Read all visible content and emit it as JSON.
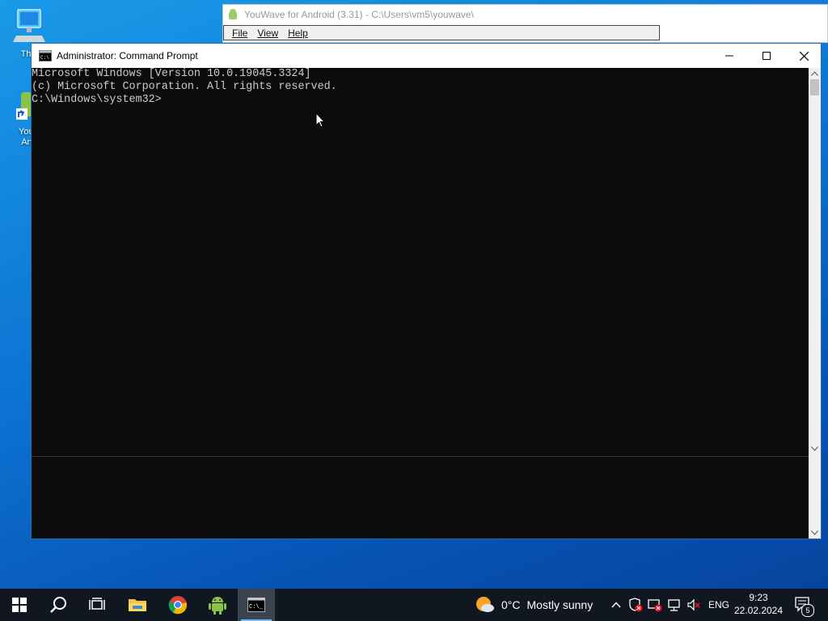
{
  "desktop": {
    "icons": [
      {
        "label": "This",
        "name": "this-pc"
      },
      {
        "label": "YouWave for Android",
        "label_line1": "YouV",
        "label_line2": "And"
      }
    ]
  },
  "youwave_window": {
    "title": "YouWave for Android (3.31) - C:\\Users\\vm5\\youwave\\",
    "menu": [
      "File",
      "View",
      "Help"
    ]
  },
  "cmd_window": {
    "title": "Administrator: Command Prompt",
    "lines": [
      "Microsoft Windows [Version 10.0.19045.3324]",
      "(c) Microsoft Corporation. All rights reserved.",
      "",
      "C:\\Windows\\system32>"
    ]
  },
  "taskbar": {
    "weather": {
      "temp": "0°C",
      "condition": "Mostly sunny"
    },
    "language": "ENG",
    "time": "9:23",
    "date": "22.02.2024",
    "notification_count": "5"
  },
  "colors": {
    "console_bg": "#0c0c0c",
    "console_text": "#cccccc",
    "taskbar_bg": "#101720",
    "accent": "#76b9ed"
  }
}
